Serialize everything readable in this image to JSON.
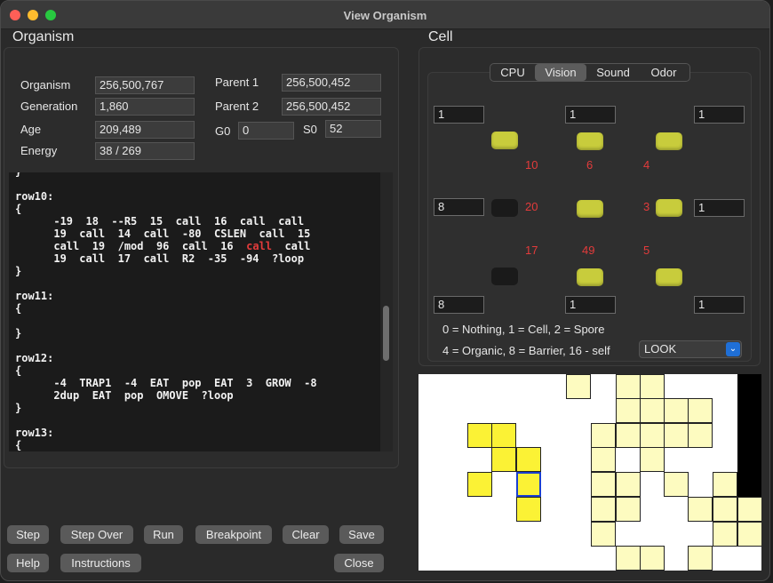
{
  "window": {
    "title": "View Organism"
  },
  "organism": {
    "section_title": "Organism",
    "fields": {
      "organism_label": "Organism",
      "organism_value": "256,500,767",
      "generation_label": "Generation",
      "generation_value": "1,860",
      "age_label": "Age",
      "age_value": "209,489",
      "energy_label": "Energy",
      "energy_value": "38 / 269",
      "parent1_label": "Parent 1",
      "parent1_value": "256,500,452",
      "parent2_label": "Parent 2",
      "parent2_value": "256,500,452",
      "g0_label": "G0",
      "g0_value": "0",
      "s0_label": "S0",
      "s0_value": "52"
    },
    "code_lines": [
      "}",
      "",
      "row10:",
      "{",
      "      -19  18  --R5  15  call  16  call  call",
      "      19  call  14  call  -80  CSLEN  call  15",
      "      call  19  /mod  96  call  16  @@call@@  call",
      "      19  call  17  call  R2  -35  -94  ?loop",
      "}",
      "",
      "row11:",
      "{",
      "",
      "}",
      "",
      "row12:",
      "{",
      "      -4  TRAP1  -4  EAT  pop  EAT  3  GROW  -8",
      "      2dup  EAT  pop  OMOVE  ?loop",
      "}",
      "",
      "row13:",
      "{"
    ]
  },
  "buttons": {
    "step": "Step",
    "step_over": "Step Over",
    "run": "Run",
    "breakpoint": "Breakpoint",
    "clear": "Clear",
    "save": "Save",
    "help": "Help",
    "instructions": "Instructions",
    "close": "Close"
  },
  "cell": {
    "section_title": "Cell",
    "tabs": [
      "CPU",
      "Vision",
      "Sound",
      "Odor"
    ],
    "active_tab": "Vision",
    "vision": {
      "fields": {
        "tl": "1",
        "tc": "1",
        "tr": "1",
        "ml": "8",
        "mr": "1",
        "bl": "8",
        "bc": "1",
        "br": "1"
      },
      "numbers": {
        "n10": "10",
        "n6": "6",
        "n4": "4",
        "n20": "20",
        "n3": "3",
        "n17": "17",
        "n49": "49",
        "n5": "5"
      },
      "legend_line1": "0 = Nothing, 1 = Cell, 2 = Spore",
      "legend_line2": "4 = Organic, 8 = Barrier, 16 - self",
      "select_value": "LOOK"
    },
    "colors": {
      "led_on": "#c8cc3c",
      "led_off": "#1a1a1a",
      "number_red": "#e33b3b",
      "cell_yellow": "#fbf235",
      "organic_pale": "#fdfbc0",
      "selected_border": "#1a3fd1"
    }
  }
}
